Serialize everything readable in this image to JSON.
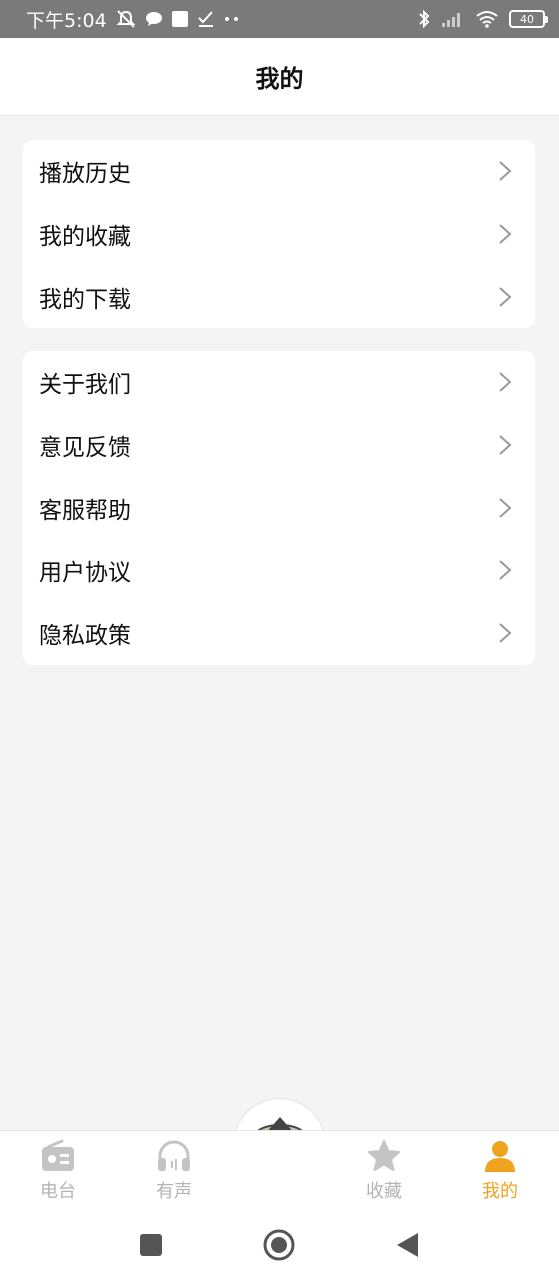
{
  "status_bar": {
    "time": "下午5:04",
    "battery": "40"
  },
  "header": {
    "title": "我的"
  },
  "menu_groups": [
    {
      "items": [
        {
          "label": "播放历史"
        },
        {
          "label": "我的收藏"
        },
        {
          "label": "我的下载"
        }
      ]
    },
    {
      "items": [
        {
          "label": "关于我们"
        },
        {
          "label": "意见反馈"
        },
        {
          "label": "客服帮助"
        },
        {
          "label": "用户协议"
        },
        {
          "label": "隐私政策"
        }
      ]
    }
  ],
  "tabbar": {
    "tabs": [
      {
        "label": "电台",
        "icon": "radio-icon"
      },
      {
        "label": "有声",
        "icon": "headphones-icon"
      },
      {
        "label": "收藏",
        "icon": "star-icon"
      },
      {
        "label": "我的",
        "icon": "user-icon",
        "active": true
      }
    ],
    "active_color": "#f0a31e",
    "inactive_color": "#b4b4b4"
  }
}
